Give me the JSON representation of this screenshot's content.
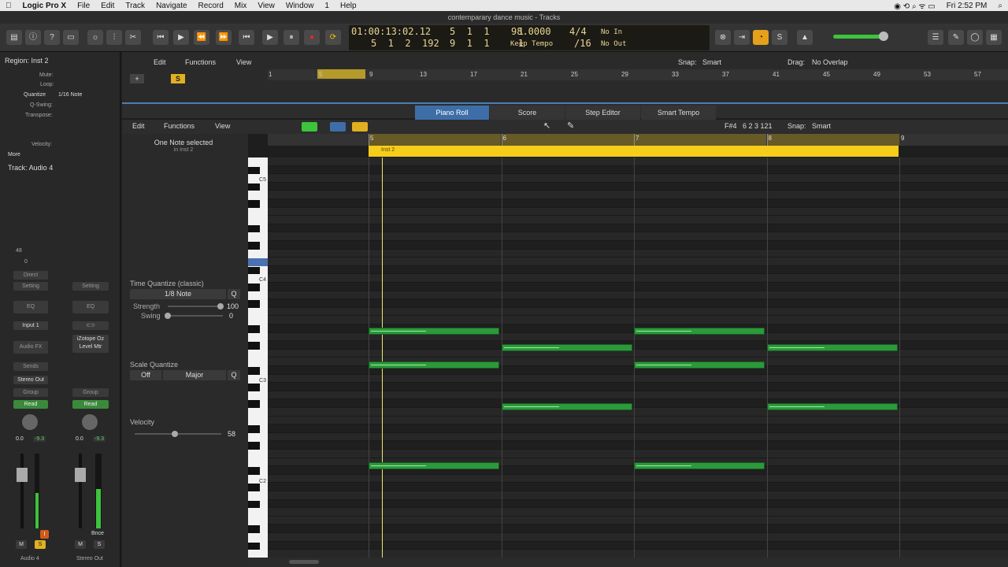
{
  "menubar": {
    "app": "Logic Pro X",
    "items": [
      "File",
      "Edit",
      "Track",
      "Navigate",
      "Record",
      "Mix",
      "View",
      "Window",
      "1",
      "Help"
    ],
    "clock": "Fri 2:52 PM"
  },
  "window": {
    "title": "contemparary dance music - Tracks"
  },
  "lcd": {
    "time": "01:00:13:02.12",
    "bars1": "5  1  1     1",
    "bars2": "5  1  2  192",
    "bars3": "9  1  1     1",
    "tempo": "98.0000",
    "tempo_mode": "Keep Tempo",
    "sig": "4/4",
    "div": "/16",
    "in": "No In",
    "out": "No Out"
  },
  "inspector": {
    "region_label": "Region: Inst 2",
    "mute": "Mute:",
    "loop": "Loop:",
    "quantize": "Quantize",
    "quantize_val": "1/16 Note",
    "qswing": "Q-Swing:",
    "transpose": "Transpose:",
    "velocity": "Velocity:",
    "more": "More",
    "track_label": "Track: Audio 4",
    "strip1": {
      "val48": "48",
      "zero": "0",
      "direct": "Direct",
      "setting": "Setting",
      "eq": "EQ",
      "input": "Input 1",
      "audiofx": "Audio FX",
      "sends": "Sends",
      "output": "Stereo Out",
      "group": "Group",
      "read": "Read",
      "vol": "0.0",
      "peak": "-9.3",
      "m": "M",
      "s": "S",
      "i": "I",
      "name": "Audio 4"
    },
    "strip2": {
      "setting": "Setting",
      "eq": "EQ",
      "plugin": "iZotope Oz Level Mtr",
      "group": "Group",
      "read": "Read",
      "vol": "0.0",
      "peak": "-9.3",
      "bnce": "Bnce",
      "m": "M",
      "s": "S",
      "name": "Stereo Out"
    }
  },
  "trackarea": {
    "edit": "Edit",
    "functions": "Functions",
    "view": "View",
    "snap_label": "Snap:",
    "snap": "Smart",
    "drag_label": "Drag:",
    "drag": "No Overlap",
    "ruler": [
      "1",
      "5",
      "9",
      "13",
      "17",
      "21",
      "25",
      "29",
      "33",
      "37",
      "41",
      "45",
      "49",
      "53",
      "57"
    ]
  },
  "tabs": [
    "Piano Roll",
    "Score",
    "Step Editor",
    "Smart Tempo"
  ],
  "pianoroll": {
    "edit": "Edit",
    "functions": "Functions",
    "view": "View",
    "position": "F#4   6 2 3 121",
    "snap_label": "Snap:",
    "snap": "Smart",
    "ruler": [
      "5",
      "6",
      "7",
      "8",
      "9"
    ],
    "region_name": "Inst 2"
  },
  "leftpane": {
    "selection": "One Note selected",
    "selection_sub": "in Inst 2",
    "tq_label": "Time Quantize (classic)",
    "tq_value": "1/8 Note",
    "q": "Q",
    "strength_label": "Strength",
    "strength": "100",
    "swing_label": "Swing",
    "swing": "0",
    "sq_label": "Scale Quantize",
    "sq_off": "Off",
    "sq_scale": "Major",
    "vel_label": "Velocity",
    "vel": "58"
  },
  "keys": {
    "c5": "C5",
    "c4": "C4",
    "c3": "C3",
    "c2": "C2"
  },
  "colors": {
    "note": "#2a9a3a",
    "note_selected": "#9fe89a",
    "region": "#f5cd1a",
    "accent": "#3d6ea8"
  }
}
